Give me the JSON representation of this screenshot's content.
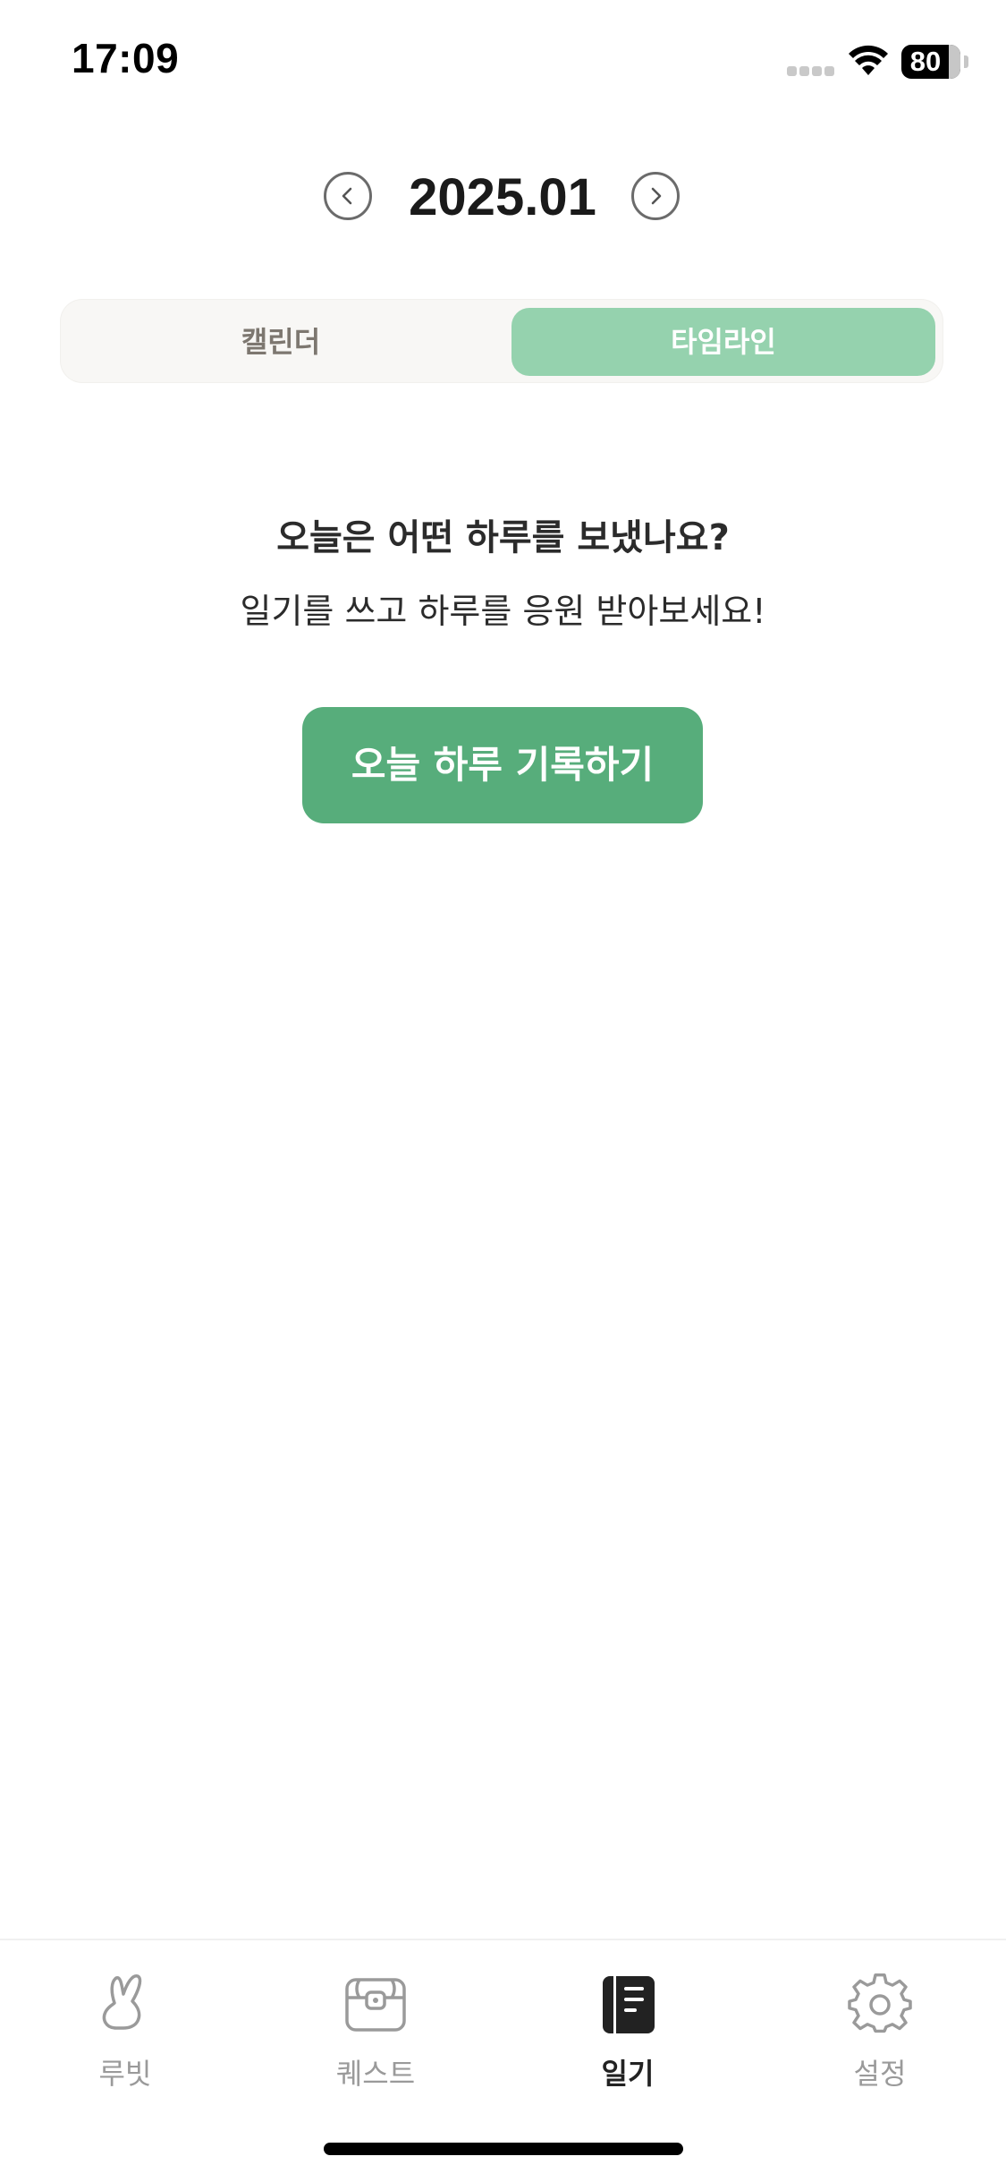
{
  "status_bar": {
    "time": "17:09",
    "battery": "80",
    "icons": [
      "signal-icon",
      "wifi-icon",
      "battery-icon"
    ]
  },
  "header": {
    "month": "2025.01",
    "prev_icon": "chevron-left-icon",
    "next_icon": "chevron-right-icon"
  },
  "view_toggle": {
    "tabs": [
      {
        "label": "캘린더",
        "selected": false
      },
      {
        "label": "타임라인",
        "selected": true
      }
    ],
    "active_color": "#95d2ae"
  },
  "empty_state": {
    "title": "오늘은 어떤 하루를 보냈나요?",
    "subtitle": "일기를 쓰고 하루를 응원 받아보세요!",
    "cta_label": "오늘 하루 기록하기",
    "cta_color": "#57ad7b"
  },
  "tab_bar": {
    "items": [
      {
        "label": "루빗",
        "icon": "rabbit-icon",
        "active": false
      },
      {
        "label": "퀘스트",
        "icon": "treasure-chest-icon",
        "active": false
      },
      {
        "label": "일기",
        "icon": "diary-icon",
        "active": true
      },
      {
        "label": "설정",
        "icon": "gear-icon",
        "active": false
      }
    ]
  }
}
